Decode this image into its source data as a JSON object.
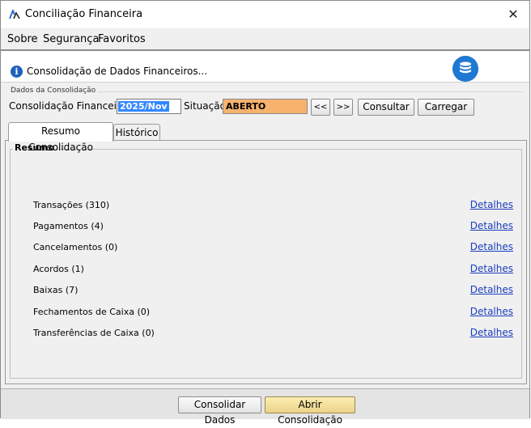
{
  "window": {
    "title": "Conciliação Financeira"
  },
  "menu": [
    {
      "label": "Sobre"
    },
    {
      "label": "Segurança"
    },
    {
      "label": "Favoritos"
    }
  ],
  "banner": {
    "text": "Consolidação de Dados Financeiros..."
  },
  "consolidacao": {
    "group_label": "Dados da Consolidação",
    "financeira_label": "Consolidação Financeira:",
    "financeira_value": "2025/Nov",
    "situacao_label": "Situação:",
    "situacao_value": "ABERTO",
    "prev_label": "<<",
    "next_label": ">>",
    "consultar_label": "Consultar",
    "carregar_label": "Carregar"
  },
  "tabs": [
    {
      "label": "Resumo Consolidação",
      "active": true
    },
    {
      "label": "Histórico",
      "active": false
    }
  ],
  "resumo": {
    "title": "Resumo",
    "rows": [
      {
        "label": "Transações (310)",
        "link": "Detalhes"
      },
      {
        "label": "Pagamentos (4)",
        "link": "Detalhes"
      },
      {
        "label": "Cancelamentos (0)",
        "link": "Detalhes"
      },
      {
        "label": "Acordos (1)",
        "link": "Detalhes"
      },
      {
        "label": "Baixas (7)",
        "link": "Detalhes"
      },
      {
        "label": "Fechamentos de Caixa (0)",
        "link": "Detalhes"
      },
      {
        "label": "Transferências de Caixa (0)",
        "link": "Detalhes"
      }
    ]
  },
  "footer": {
    "consolidar_label": "Consolidar Dados",
    "abrir_label": "Abrir Consolidação"
  },
  "colors": {
    "status_bg": "#f7b26e",
    "link": "#1a3fbf",
    "primary_button": "#ecd28a",
    "selection": "#3388ff"
  }
}
